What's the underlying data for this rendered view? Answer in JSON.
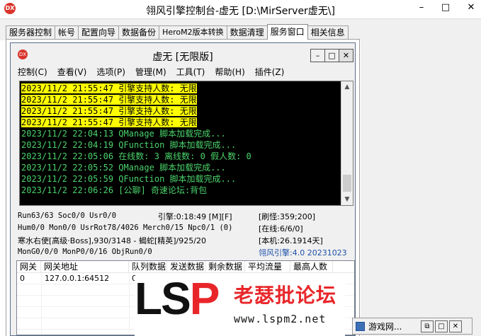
{
  "window": {
    "title": "翎风引擎控制台-虚无 [D:\\MirServer虚无\\]",
    "logo_text": "DX",
    "minimize": "–",
    "maximize": "□",
    "close": "✕"
  },
  "tabs": [
    {
      "label": "服务器控制"
    },
    {
      "label": "帐号"
    },
    {
      "label": "配置向导"
    },
    {
      "label": "数据备份"
    },
    {
      "label": "HeroM2版本转换"
    },
    {
      "label": "数据清理"
    },
    {
      "label": "服务窗口",
      "active": true
    },
    {
      "label": "相关信息"
    }
  ],
  "inner_window": {
    "title": "虚无 [无限版]",
    "logo_text": "DX",
    "minimize": "–",
    "maximize": "□",
    "close": "✕"
  },
  "menu": [
    "控制(C)",
    "查看(V)",
    "选项(P)",
    "管理(M)",
    "工具(T)",
    "帮助(H)",
    "插件(Z)"
  ],
  "console": {
    "lines": [
      {
        "text": "2023/11/2 21:55:47 引擎支持人数: 无限",
        "highlight": true
      },
      {
        "text": "2023/11/2 21:55:47 引擎支持人数: 无限",
        "highlight": true
      },
      {
        "text": "2023/11/2 21:55:47 引擎支持人数: 无限",
        "highlight": true
      },
      {
        "text": "2023/11/2 21:55:47 引擎支持人数: 无限",
        "highlight": true
      },
      {
        "text": "2023/11/2 22:04:13 QManage 脚本加载完成...",
        "highlight": false
      },
      {
        "text": "2023/11/2 22:04:19 QFunction 脚本加载完成...",
        "highlight": false
      },
      {
        "text": "2023/11/2 22:05:06 在线数: 3 离线数: 0 假人数: 0",
        "highlight": false
      },
      {
        "text": "2023/11/2 22:05:52 QManage 脚本加载完成...",
        "highlight": false
      },
      {
        "text": "2023/11/2 22:05:59 QFunction 脚本加载完成...",
        "highlight": false
      },
      {
        "text": "2023/11/2 22:06:26 [公聊] 奇速论坛:背包",
        "highlight": false
      }
    ],
    "scroll_up": "▲",
    "scroll_down": "▼"
  },
  "status": {
    "run": "Run63/63 Soc0/0 Usr0/0",
    "engine_time": "引擎:0:18:49 [M][F]",
    "refresh": "[刷怪:359;200]",
    "hum": "Hum0/0 Mon0/0 UsrRot78/4026 Merch0/15 Npc0/1 (0)",
    "online": "[在线:6/6/0]",
    "boss": "寒水右使[高级·Boss],930/3148 - 蝎蛇[精英]/925/20",
    "local": "[本机:26.1914天]",
    "mongo": "MonG0/0/0 MonP0/0/16 ObjRun0/0",
    "version": "翎风引擎:4.0 20231023"
  },
  "gateway_list": {
    "headers": [
      "网关",
      "网关地址",
      "队列数据",
      "发送数据",
      "剩余数据",
      "平均流量",
      "最高人数"
    ],
    "rows": [
      [
        "0",
        "127.0.0.1:64512",
        "0",
        "",
        "",
        "",
        ""
      ]
    ]
  },
  "watermark": {
    "brand_l": "LS",
    "brand_p": "P",
    "forum": "老瑟批论坛",
    "url": "www.lspm2.net"
  },
  "minimized_window": {
    "title": "游戏网...",
    "restore": "⧉",
    "maximize": "□",
    "close": "✕"
  }
}
